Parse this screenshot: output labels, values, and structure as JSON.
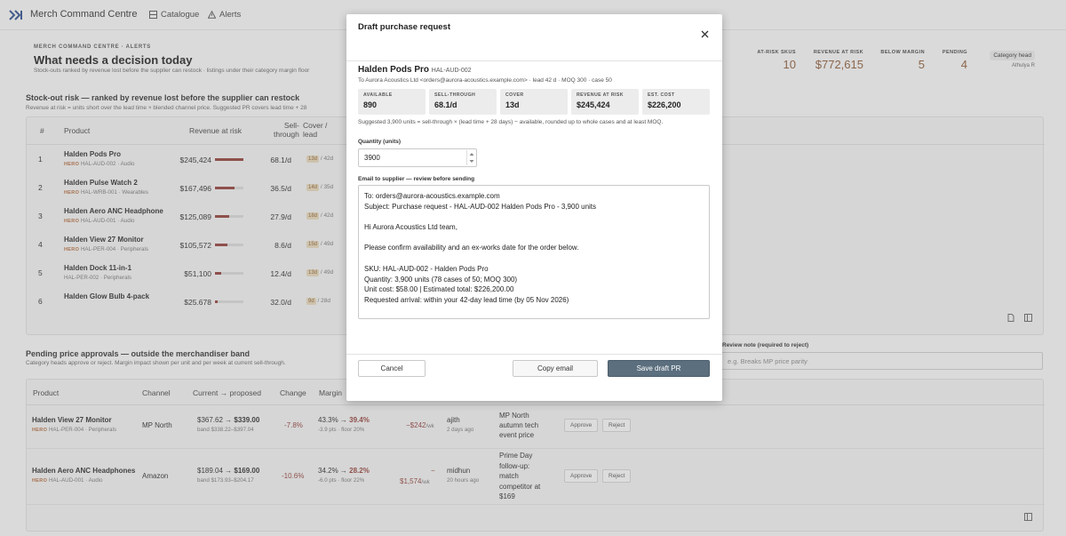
{
  "nav": {
    "brand": "Merch Command Centre",
    "tabs": [
      {
        "label": "Catalogue",
        "icon": "grid-icon"
      },
      {
        "label": "Alerts",
        "icon": "warning-icon"
      }
    ]
  },
  "header": {
    "eyebrow": "MERCH COMMAND CENTRE · ALERTS",
    "title": "What needs a decision today",
    "subtitle": "Stock-outs ranked by revenue lost before the supplier can restock · listings under their category margin floor",
    "kpis": [
      {
        "label": "AT-RISK SKUS",
        "value": "10"
      },
      {
        "label": "REVENUE AT RISK",
        "value": "$772,615"
      },
      {
        "label": "BELOW MARGIN",
        "value": "5"
      },
      {
        "label": "PENDING",
        "value": "4"
      }
    ],
    "role": {
      "label": "Category head",
      "user": "Athulya R"
    }
  },
  "stockout": {
    "title": "Stock-out risk — ranked by revenue lost before the supplier can restock",
    "subtitle": "Revenue at risk = units short over the lead time × blended channel price. Suggested PR covers lead time + 28",
    "columns": {
      "num": "#",
      "product": "Product",
      "revenue": "Revenue at risk",
      "sell1": "Sell-",
      "sell2": "through",
      "cover1": "Cover /",
      "cover2": "lead"
    },
    "rows": [
      {
        "num": "1",
        "name": "Halden Pods Pro",
        "hero": "HERO",
        "sku": "HAL-AUD-002 · Audio",
        "revenue": "$245,424",
        "risk": 1.0,
        "sell": "68.1/d",
        "cover": "13d",
        "lead": "/ 42d"
      },
      {
        "num": "2",
        "name": "Halden Pulse Watch 2",
        "hero": "HERO",
        "sku": "HAL-WRB-001 · Wearables",
        "revenue": "$167,496",
        "risk": 0.68,
        "sell": "36.5/d",
        "cover": "14d",
        "lead": "/ 35d"
      },
      {
        "num": "3",
        "name": "Halden Aero ANC Headphone",
        "hero": "HERO",
        "sku": "HAL-AUD-001 · Audio",
        "revenue": "$125,089",
        "risk": 0.51,
        "sell": "27.9/d",
        "cover": "18d",
        "lead": "/ 42d"
      },
      {
        "num": "4",
        "name": "Halden View 27 Monitor",
        "hero": "HERO",
        "sku": "HAL-PER-004 · Peripherals",
        "revenue": "$105,572",
        "risk": 0.43,
        "sell": "8.6/d",
        "cover": "15d",
        "lead": "/ 49d"
      },
      {
        "num": "5",
        "name": "Halden Dock 11-in-1",
        "hero": "",
        "sku": "HAL-PER-002 · Peripherals",
        "revenue": "$51,100",
        "risk": 0.21,
        "sell": "12.4/d",
        "cover": "13d",
        "lead": "/ 49d"
      },
      {
        "num": "6",
        "name": "Halden Glow Bulb 4-pack",
        "hero": "",
        "sku": "",
        "revenue": "$25,678",
        "risk": 0.1,
        "sell": "32.0/d",
        "cover": "9d",
        "lead": "/ 28d"
      }
    ]
  },
  "pending": {
    "title": "Pending price approvals — outside the merchandiser band",
    "subtitle": "Category heads approve or reject. Margin impact shown per unit and per week at current sell-through.",
    "columns": {
      "product": "Product",
      "channel": "Channel",
      "current": "Current → proposed",
      "change": "Change",
      "margin": "Margin"
    },
    "review_label": "Review note (required to reject)",
    "review_placeholder": "e.g. Breaks MP price parity",
    "rows": [
      {
        "name": "Halden View 27 Monitor",
        "hero": "HERO",
        "sku": "HAL-PER-004 · Peripherals",
        "channel": "MP North",
        "current": "$367.62",
        "arrow": "→",
        "proposed": "$339.00",
        "band": "band $338.22–$397.04",
        "change": "-7.8%",
        "m_from": "43.3%",
        "m_to": "39.4%",
        "m_sub": "-3.9 pts · floor 20%",
        "impact": "−$242",
        "impact_unit": "/wk",
        "user": "ajith",
        "when": "2 days ago",
        "reason": [
          "MP North",
          "autumn tech",
          "event price"
        ],
        "approve": "Approve",
        "reject": "Reject"
      },
      {
        "name": "Halden Aero ANC Headphones",
        "hero": "HERO",
        "sku": "HAL-AUD-001 · Audio",
        "channel": "Amazon",
        "current": "$189.04",
        "arrow": "→",
        "proposed": "$169.00",
        "band": "band $173.93–$204.17",
        "change": "-10.6%",
        "m_from": "34.2%",
        "m_to": "28.2%",
        "m_sub": "-6.0 pts · floor 22%",
        "impact_a": "−",
        "impact": "$1,574",
        "impact_unit": "/wk",
        "user": "midhun",
        "when": "20 hours ago",
        "reason": [
          "Prime Day",
          "follow-up:",
          "match",
          "competitor at",
          "$169"
        ],
        "approve": "Approve",
        "reject": "Reject"
      }
    ]
  },
  "modal": {
    "title": "Draft purchase request",
    "product": "Halden Pods Pro",
    "sku": "HAL-AUD-002",
    "to_line": "To Aurora Acoustics Ltd <orders@aurora-acoustics.example.com> · lead 42 d · MOQ 300 · case 50",
    "cards": [
      {
        "label": "AVAILABLE",
        "value": "890"
      },
      {
        "label": "SELL-THROUGH",
        "value": "68.1/d"
      },
      {
        "label": "COVER",
        "value": "13d"
      },
      {
        "label": "REVENUE AT RISK",
        "value": "$245,424"
      },
      {
        "label": "EST. COST",
        "value": "$226,200"
      }
    ],
    "suggestion": "Suggested 3,900 units = sell-through × (lead time + 28 days) − available, rounded up to whole cases and at least MOQ.",
    "qty_label": "Quantity (units)",
    "qty_value": "3900",
    "email_label": "Email to supplier — review before sending",
    "email_lines": [
      "To: orders@aurora-acoustics.example.com",
      "Subject: Purchase request - HAL-AUD-002 Halden Pods Pro - 3,900 units",
      "",
      "Hi Aurora Acoustics Ltd team,",
      "",
      "Please confirm availability and an ex-works date for the order below.",
      "",
      "SKU: HAL-AUD-002 - Halden Pods Pro",
      "Quantity: 3,900 units (78 cases of 50; MOQ 300)",
      "Unit cost: $58.00 | Estimated total: $226,200.00",
      "Requested arrival: within your 42-day lead time (by 05 Nov 2026)"
    ],
    "cancel": "Cancel",
    "copy": "Copy email",
    "save": "Save draft PR"
  }
}
